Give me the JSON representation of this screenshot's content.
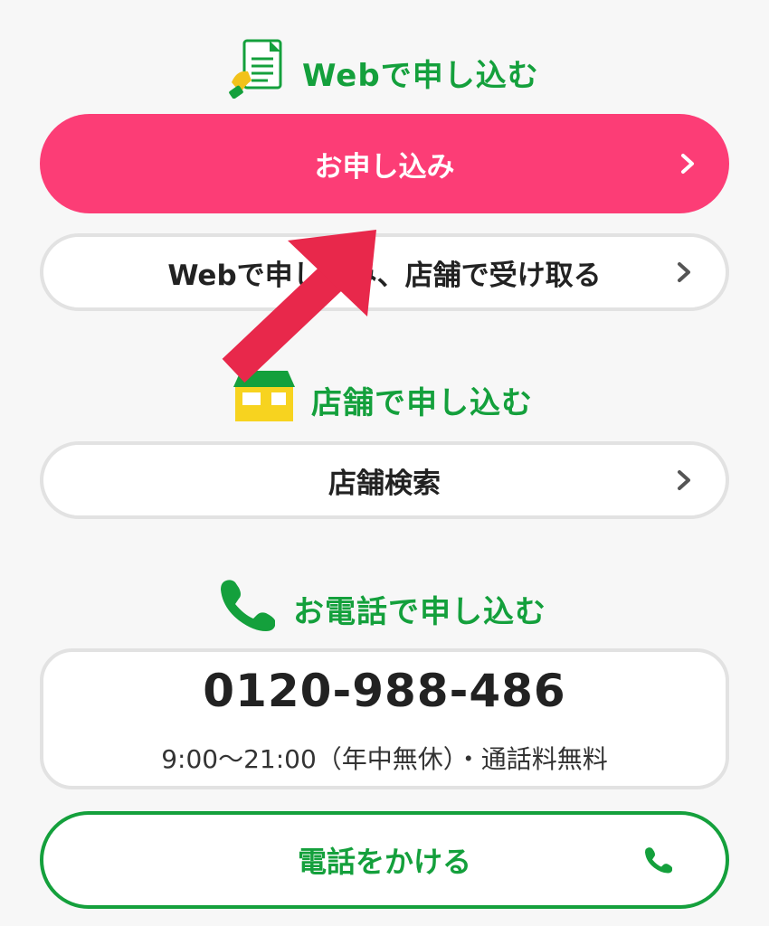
{
  "web_section": {
    "heading": "Webで申し込む",
    "icon": "document-hand-icon",
    "apply_button_label": "お申し込み",
    "pickup_button_label": "Webで申し込み、店舗で受け取る"
  },
  "store_section": {
    "heading": "店舗で申し込む",
    "icon": "store-icon",
    "search_button_label": "店舗検索"
  },
  "phone_section": {
    "heading": "お電話で申し込む",
    "icon": "phone-icon",
    "number": "0120-988-486",
    "hours": "9:00～21:00（年中無休）・通話料無料",
    "call_button_label": "電話をかける"
  },
  "colors": {
    "accent_pink": "#fc3d76",
    "brand_green": "#14a03c",
    "annotation_arrow": "#e8284b"
  }
}
